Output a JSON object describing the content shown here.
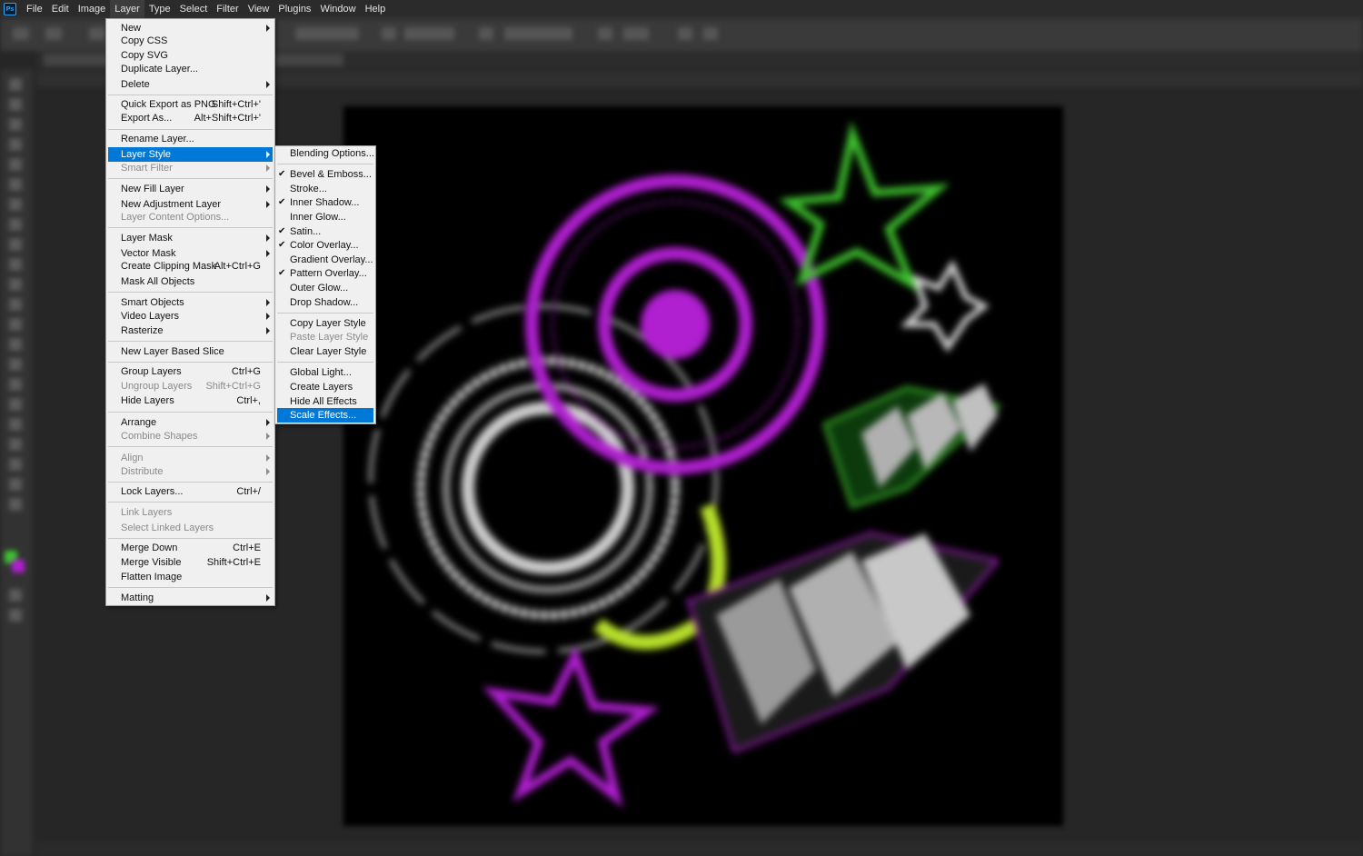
{
  "app": {
    "logo_text": "Ps"
  },
  "menubar": {
    "items": [
      "File",
      "Edit",
      "Image",
      "Layer",
      "Type",
      "Select",
      "Filter",
      "View",
      "Plugins",
      "Window",
      "Help"
    ],
    "active": "Layer"
  },
  "layer_menu": {
    "new": "New",
    "copy_css": "Copy CSS",
    "copy_svg": "Copy SVG",
    "duplicate_layer": "Duplicate Layer...",
    "delete": "Delete",
    "quick_export": "Quick Export as PNG",
    "quick_export_shortcut": "Shift+Ctrl+'",
    "export_as": "Export As...",
    "export_as_shortcut": "Alt+Shift+Ctrl+'",
    "rename_layer": "Rename Layer...",
    "layer_style": "Layer Style",
    "smart_filter": "Smart Filter",
    "new_fill_layer": "New Fill Layer",
    "new_adjustment_layer": "New Adjustment Layer",
    "layer_content_options": "Layer Content Options...",
    "layer_mask": "Layer Mask",
    "vector_mask": "Vector Mask",
    "create_clipping_mask": "Create Clipping Mask",
    "create_clipping_mask_shortcut": "Alt+Ctrl+G",
    "mask_all_objects": "Mask All Objects",
    "smart_objects": "Smart Objects",
    "video_layers": "Video Layers",
    "rasterize": "Rasterize",
    "new_layer_based_slice": "New Layer Based Slice",
    "group_layers": "Group Layers",
    "group_layers_shortcut": "Ctrl+G",
    "ungroup_layers": "Ungroup Layers",
    "ungroup_layers_shortcut": "Shift+Ctrl+G",
    "hide_layers": "Hide Layers",
    "hide_layers_shortcut": "Ctrl+,",
    "arrange": "Arrange",
    "combine_shapes": "Combine Shapes",
    "align": "Align",
    "distribute": "Distribute",
    "lock_layers": "Lock Layers...",
    "lock_layers_shortcut": "Ctrl+/",
    "link_layers": "Link Layers",
    "select_linked_layers": "Select Linked Layers",
    "merge_down": "Merge Down",
    "merge_down_shortcut": "Ctrl+E",
    "merge_visible": "Merge Visible",
    "merge_visible_shortcut": "Shift+Ctrl+E",
    "flatten_image": "Flatten Image",
    "matting": "Matting"
  },
  "layer_style_menu": {
    "blending_options": "Blending Options...",
    "bevel_emboss": "Bevel & Emboss...",
    "stroke": "Stroke...",
    "inner_shadow": "Inner Shadow...",
    "inner_glow": "Inner Glow...",
    "satin": "Satin...",
    "color_overlay": "Color Overlay...",
    "gradient_overlay": "Gradient Overlay...",
    "pattern_overlay": "Pattern Overlay...",
    "outer_glow": "Outer Glow...",
    "drop_shadow": "Drop Shadow...",
    "copy_layer_style": "Copy Layer Style",
    "paste_layer_style": "Paste Layer Style",
    "clear_layer_style": "Clear Layer Style",
    "global_light": "Global Light...",
    "create_layers": "Create Layers",
    "hide_all_effects": "Hide All Effects",
    "scale_effects": "Scale Effects...",
    "checked": [
      "Bevel & Emboss...",
      "Inner Shadow...",
      "Satin...",
      "Color Overlay...",
      "Pattern Overlay..."
    ]
  },
  "colors": {
    "accent": "#0078d7",
    "menu_bg": "#f0f0f0",
    "app_bg": "#262626",
    "art_purple": "#b01fd0",
    "art_green": "#3ec22e"
  }
}
